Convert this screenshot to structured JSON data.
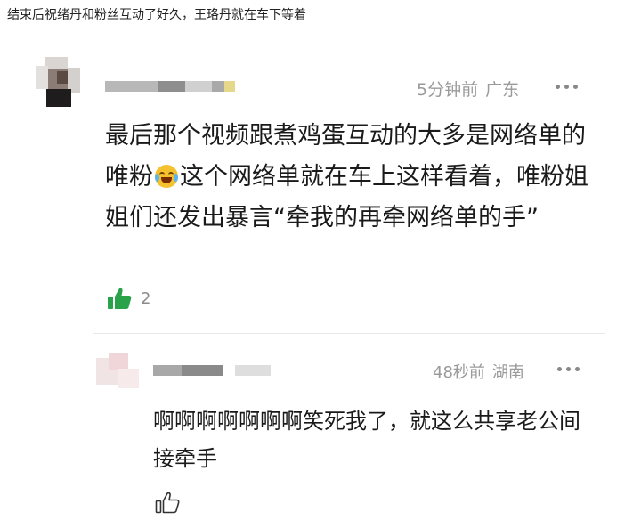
{
  "caption": "结束后祝绪丹和粉丝互动了好久，王珞丹就在车下等着",
  "comment": {
    "time": "5分钟前",
    "location": "广东",
    "text_before_emoji": "最后那个视频跟煮鸡蛋互动的大多是网络单的唯粉",
    "text_after_emoji": "这个网络单就在车上这样看着，唯粉姐姐们还发出暴言“牵我的再牵网络单的手”",
    "like_count": "2",
    "colors": {
      "like_icon": "#2aa24a",
      "meta_text": "#9a9a9a"
    }
  },
  "reply": {
    "time": "48秒前",
    "location": "湖南",
    "text": "啊啊啊啊啊啊啊笑死我了，就这么共享老公间接牵手"
  },
  "icons": {
    "comment_more": "more-dots-icon",
    "comment_like": "thumbs-up-filled-icon",
    "emoji": "laughing-crying-emoji-icon",
    "reply_more": "more-dots-icon",
    "reply_like": "thumbs-up-outline-icon"
  }
}
